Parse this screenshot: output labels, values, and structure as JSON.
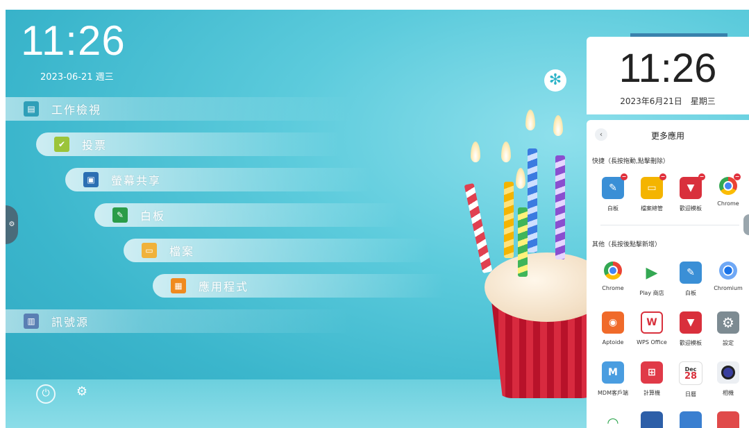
{
  "home": {
    "time": "11:26",
    "date": "2023-06-21 週三"
  },
  "menu": [
    {
      "label": "工作檢視",
      "icon": "workview-icon",
      "color": "#2f9fb8"
    },
    {
      "label": "投票",
      "icon": "vote-icon",
      "color": "#9bc43a"
    },
    {
      "label": "螢幕共享",
      "icon": "screen-share-icon",
      "color": "#2b6fb3"
    },
    {
      "label": "白板",
      "icon": "whiteboard-icon",
      "color": "#2a9c49"
    },
    {
      "label": "檔案",
      "icon": "folder-icon",
      "color": "#f0b23a"
    },
    {
      "label": "應用程式",
      "icon": "apps-grid-icon",
      "color": "#f08a1e"
    },
    {
      "label": "訊號源",
      "icon": "signal-source-icon",
      "color": "#5a7fb3"
    }
  ],
  "panel": {
    "time": "11:26",
    "date": "2023年6月21日　星期三",
    "title": "更多應用",
    "quick_section": "快捷（長按拖動,點擊刪除）",
    "other_section": "其他（長按後點擊新增）",
    "quick_apps": [
      {
        "name": "白板",
        "icon": "whiteboard-icon",
        "color": "#3a8fd6"
      },
      {
        "name": "檔案總管",
        "icon": "folder-icon",
        "color": "#f4b400"
      },
      {
        "name": "歡迎模板",
        "icon": "tie-icon",
        "color": "#d9303c"
      },
      {
        "name": "Chrome",
        "icon": "chrome-icon",
        "color": "#ffffff"
      }
    ],
    "other_apps": [
      {
        "name": "Chrome",
        "icon": "chrome-icon",
        "color": "#ffffff"
      },
      {
        "name": "Play 商店",
        "icon": "play-store-icon",
        "color": "#ffffff"
      },
      {
        "name": "白板",
        "icon": "whiteboard-icon",
        "color": "#3a8fd6"
      },
      {
        "name": "Chromium",
        "icon": "chromium-icon",
        "color": "#ffffff"
      },
      {
        "name": "Aptoide",
        "icon": "aptoide-icon",
        "color": "#f06a2a"
      },
      {
        "name": "WPS Office",
        "icon": "wps-icon",
        "color": "#ffffff"
      },
      {
        "name": "歡迎模板",
        "icon": "tie-icon",
        "color": "#d9303c"
      },
      {
        "name": "設定",
        "icon": "gear-icon",
        "color": "#7d8b92"
      },
      {
        "name": "MDM客戶端",
        "icon": "mdm-icon",
        "color": "#4a9de0"
      },
      {
        "name": "計算機",
        "icon": "calculator-icon",
        "color": "#e03a48"
      },
      {
        "name": "日曆",
        "icon": "calendar-icon",
        "color": "#ffffff",
        "month": "Dec",
        "day": "28"
      },
      {
        "name": "相機",
        "icon": "camera-icon",
        "color": "#ffffff"
      }
    ]
  }
}
